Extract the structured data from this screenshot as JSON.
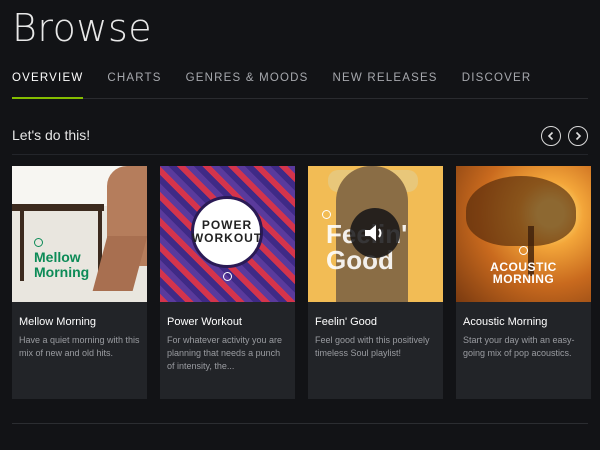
{
  "page": {
    "title": "Browse"
  },
  "tabs": [
    {
      "label": "OVERVIEW",
      "active": true
    },
    {
      "label": "CHARTS",
      "active": false
    },
    {
      "label": "GENRES & MOODS",
      "active": false
    },
    {
      "label": "NEW RELEASES",
      "active": false
    },
    {
      "label": "DISCOVER",
      "active": false
    }
  ],
  "section": {
    "title": "Let's do this!",
    "prev_icon": "chevron-left-icon",
    "next_icon": "chevron-right-icon"
  },
  "cards": [
    {
      "art_label": "Mellow Morning",
      "title": "Mellow Morning",
      "description": "Have a quiet morning with this mix of new and old hits."
    },
    {
      "art_label_1": "POWER",
      "art_label_2": "WORKOUT",
      "title": "Power Workout",
      "description": "For whatever activity you are planning that needs a punch of intensity, the..."
    },
    {
      "art_label": "Feelin' Good",
      "title": "Feelin' Good",
      "description": "Feel good with this positively timeless Soul playlist!",
      "overlay_icon": "speaker-icon"
    },
    {
      "art_label_1": "ACOUSTIC",
      "art_label_2": "MORNING",
      "title": "Acoustic Morning",
      "description": "Start your day with an easy-going mix of pop acoustics."
    }
  ],
  "colors": {
    "background": "#121316",
    "card": "#222428",
    "accent": "#84bd00",
    "mellow_green": "#0d8b57"
  }
}
